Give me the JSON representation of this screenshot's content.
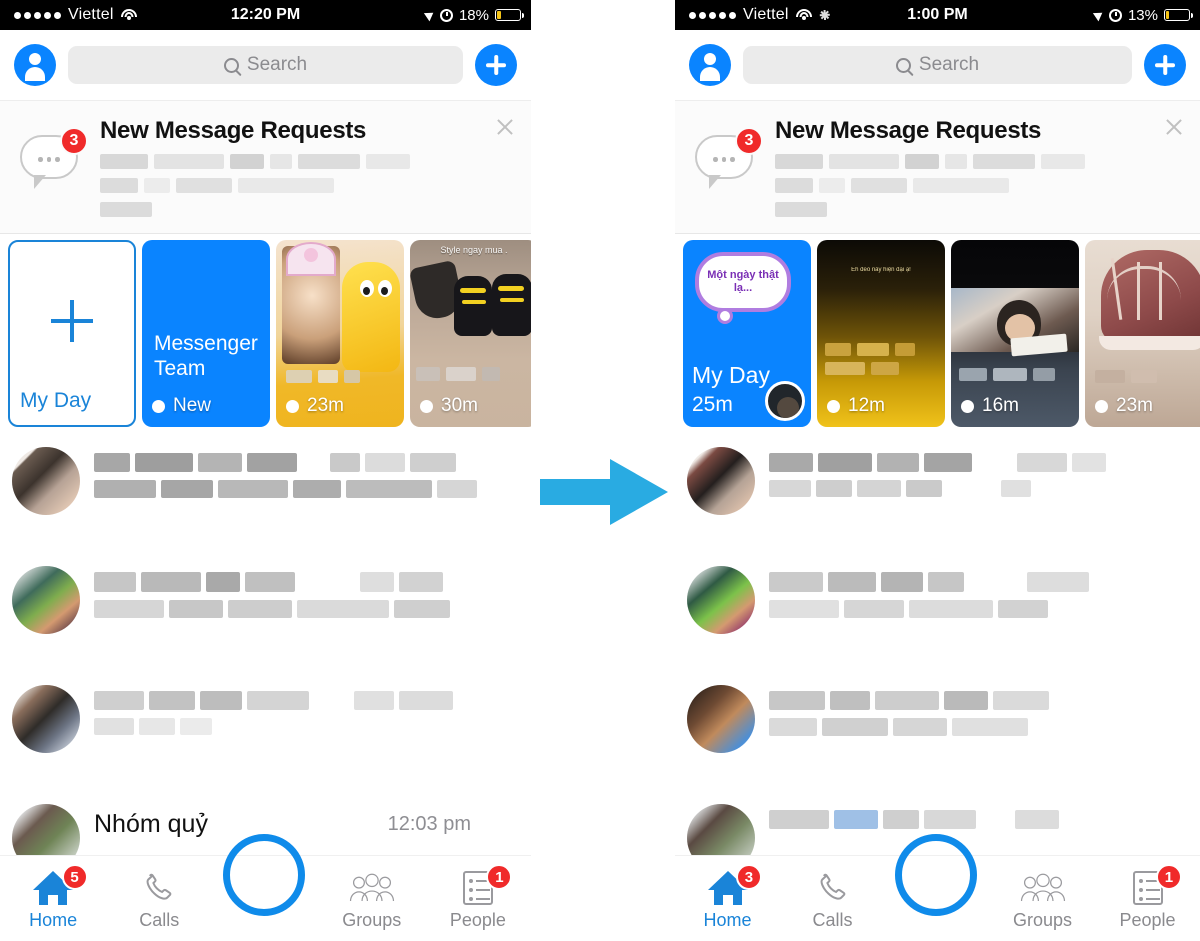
{
  "meta": {
    "accent_blue": "#0a84ff",
    "badge_red": "#f02a2a",
    "arrow_color": "#29ABE2",
    "ring_color": "#0f8bea",
    "app": "Messenger"
  },
  "arrow": {
    "name": "transition-arrow",
    "direction": "right"
  },
  "phones": [
    {
      "id": "before",
      "status_bar": {
        "carrier": "Viettel",
        "signal_dots": 5,
        "wifi": "wifi-icon",
        "spinner": false,
        "time": "12:20 PM",
        "location": "location-arrow-icon",
        "alarm": "alarm-clock-icon",
        "battery_percent": "18%",
        "battery_level": 18
      },
      "navbar": {
        "avatar_icon": "profile-avatar-icon",
        "search_placeholder": "Search",
        "search_value": "",
        "search_icon": "search-icon",
        "compose_icon": "plus-icon"
      },
      "message_requests": {
        "title": "New Message Requests",
        "badge": "3",
        "icon": "chat-bubble-icon",
        "close_icon": "close-icon",
        "preview_redacted": true
      },
      "stories": [
        {
          "type": "add",
          "label": "My Day",
          "plus_icon": "plus-icon"
        },
        {
          "type": "team",
          "name": "Messenger Team",
          "status": "New",
          "unseen": true
        },
        {
          "type": "photo",
          "time": "23m",
          "unseen": true,
          "caption": ""
        },
        {
          "type": "photo",
          "time": "30m",
          "unseen": true,
          "caption": "Style ngay mua ."
        }
      ],
      "chats": [
        {
          "redacted": true
        },
        {
          "redacted": true
        },
        {
          "redacted": true
        },
        {
          "redacted": false,
          "name": "Nhóm quỷ",
          "time": "12:03 pm"
        }
      ],
      "tabs": [
        {
          "key": "home",
          "label": "Home",
          "icon": "home-icon",
          "badge": "5",
          "active": true
        },
        {
          "key": "calls",
          "label": "Calls",
          "icon": "phone-icon",
          "badge": "",
          "active": false
        },
        {
          "key": "camera",
          "label": "",
          "icon": "camera-icon",
          "badge": "",
          "active": false
        },
        {
          "key": "groups",
          "label": "Groups",
          "icon": "groups-icon",
          "badge": "",
          "active": false
        },
        {
          "key": "people",
          "label": "People",
          "icon": "people-icon",
          "badge": "1",
          "active": false
        }
      ],
      "tap_highlight": {
        "on": "camera",
        "shape": "circle"
      }
    },
    {
      "id": "after",
      "status_bar": {
        "carrier": "Viettel",
        "signal_dots": 5,
        "wifi": "wifi-icon",
        "spinner": true,
        "time": "1:00 PM",
        "location": "location-arrow-icon",
        "alarm": "alarm-clock-icon",
        "battery_percent": "13%",
        "battery_level": 13
      },
      "navbar": {
        "avatar_icon": "profile-avatar-icon",
        "search_placeholder": "Search",
        "search_value": "",
        "search_icon": "search-icon",
        "compose_icon": "plus-icon"
      },
      "message_requests": {
        "title": "New Message Requests",
        "badge": "3",
        "icon": "chat-bubble-icon",
        "close_icon": "close-icon",
        "preview_redacted": true
      },
      "stories": [
        {
          "type": "myday-posted",
          "label": "My Day",
          "time": "25m",
          "sticker_text": "Một ngày thật lạ..."
        },
        {
          "type": "photo",
          "time": "12m",
          "unseen": true,
          "caption": "Eh đeo này hiện đại ạ!"
        },
        {
          "type": "photo",
          "time": "16m",
          "unseen": true,
          "caption": ""
        },
        {
          "type": "photo",
          "time": "23m",
          "unseen": true,
          "caption": ""
        }
      ],
      "chats": [
        {
          "redacted": true
        },
        {
          "redacted": true
        },
        {
          "redacted": true
        },
        {
          "redacted": true
        }
      ],
      "tabs": [
        {
          "key": "home",
          "label": "Home",
          "icon": "home-icon",
          "badge": "3",
          "active": true
        },
        {
          "key": "calls",
          "label": "Calls",
          "icon": "phone-icon",
          "badge": "",
          "active": false
        },
        {
          "key": "camera",
          "label": "",
          "icon": "camera-icon",
          "badge": "",
          "active": false
        },
        {
          "key": "groups",
          "label": "Groups",
          "icon": "groups-icon",
          "badge": "",
          "active": false
        },
        {
          "key": "people",
          "label": "People",
          "icon": "people-icon",
          "badge": "1",
          "active": false
        }
      ],
      "tap_highlight": {
        "on": "camera",
        "shape": "circle"
      }
    }
  ]
}
